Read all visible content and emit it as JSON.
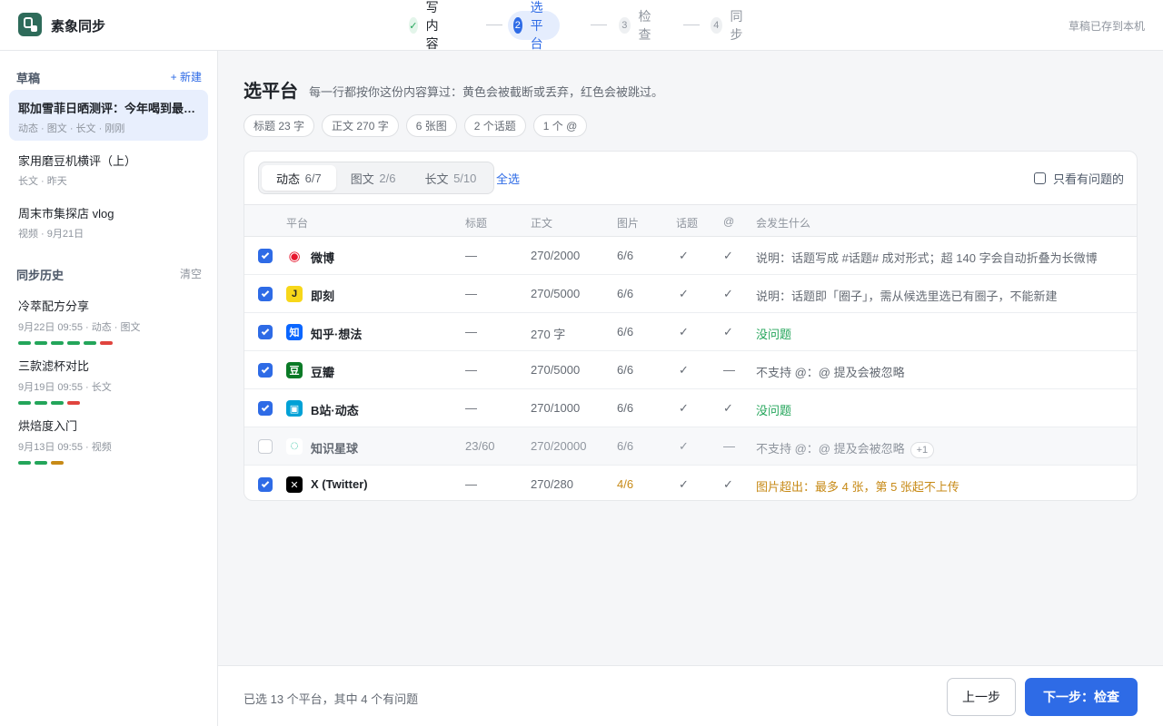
{
  "app": {
    "name": "素象同步",
    "saved_status": "草稿已存到本机"
  },
  "steps": [
    {
      "num": "✓",
      "label": "写内容"
    },
    {
      "num": "2",
      "label": "选平台"
    },
    {
      "num": "3",
      "label": "检查"
    },
    {
      "num": "4",
      "label": "同步"
    }
  ],
  "sidebar": {
    "drafts_title": "草稿",
    "new_label": "+ 新建",
    "drafts": [
      {
        "title": "耶加雪菲日晒测评：今年喝到最好的一支",
        "meta": "动态 · 图文 · 长文 · 刚刚"
      },
      {
        "title": "家用磨豆机横评（上）",
        "meta": "长文 · 昨天"
      },
      {
        "title": "周末市集探店 vlog",
        "meta": "视频 · 9月21日"
      }
    ],
    "history_title": "同步历史",
    "clear_label": "清空",
    "history": [
      {
        "title": "冷萃配方分享",
        "meta": "9月22日 09:55 · 动态 · 图文",
        "bars": [
          "green",
          "green",
          "green",
          "green",
          "green",
          "red"
        ]
      },
      {
        "title": "三款滤杯对比",
        "meta": "9月19日 09:55 · 长文",
        "bars": [
          "green",
          "green",
          "green",
          "red"
        ]
      },
      {
        "title": "烘焙度入门",
        "meta": "9月13日 09:55 · 视频",
        "bars": [
          "green",
          "green",
          "orange"
        ]
      }
    ]
  },
  "main": {
    "title": "选平台",
    "subtitle": "每一行都按你这份内容算过：黄色会被截断或丢弃，红色会被跳过。",
    "chips": [
      "标题 23 字",
      "正文 270 字",
      "6 张图",
      "2 个话题",
      "1 个 @"
    ],
    "tabs": [
      {
        "label": "动态",
        "count": "6/7"
      },
      {
        "label": "图文",
        "count": "2/6"
      },
      {
        "label": "长文",
        "count": "5/10"
      }
    ],
    "select_all": "全选",
    "only_problems": "只看有问题的",
    "columns": {
      "platform": "平台",
      "title": "标题",
      "body": "正文",
      "images": "图片",
      "topics": "话题",
      "at": "@",
      "what": "会发生什么"
    },
    "rows": [
      {
        "name": "微博",
        "icon": "weibo-icon",
        "glyph": "◉",
        "color": "#e6162d",
        "checked": true,
        "title": "—",
        "body": "270/2000",
        "images": "6/6",
        "topics": "✓",
        "at": "✓",
        "note": "说明：话题写成 #话题# 成对形式；超 140 字会自动折叠为长微博",
        "status": "info"
      },
      {
        "name": "即刻",
        "icon": "jike-icon",
        "glyph": "J",
        "color": "#f7d71a",
        "checked": true,
        "title": "—",
        "body": "270/5000",
        "images": "6/6",
        "topics": "✓",
        "at": "✓",
        "note": "说明：话题即「圈子」，需从候选里选已有圈子，不能新建",
        "status": "info"
      },
      {
        "name": "知乎·想法",
        "icon": "zhihu-icon",
        "glyph": "知",
        "color": "#0a66ff",
        "checked": true,
        "title": "—",
        "body": "270 字",
        "images": "6/6",
        "topics": "✓",
        "at": "✓",
        "note": "没问题",
        "status": "ok"
      },
      {
        "name": "豆瓣",
        "icon": "douban-icon",
        "glyph": "豆",
        "color": "#0a7a26",
        "checked": true,
        "title": "—",
        "body": "270/5000",
        "images": "6/6",
        "topics": "✓",
        "at": "—",
        "note": "不支持 @：@ 提及会被忽略",
        "status": "info"
      },
      {
        "name": "B站·动态",
        "icon": "bilibili-icon",
        "glyph": "▣",
        "color": "#00a1d6",
        "checked": true,
        "title": "—",
        "body": "270/1000",
        "images": "6/6",
        "topics": "✓",
        "at": "✓",
        "note": "没问题",
        "status": "ok"
      },
      {
        "name": "知识星球",
        "icon": "zsxq-icon",
        "glyph": "◌",
        "color": "#3ec5a8",
        "checked": false,
        "title": "23/60",
        "body": "270/20000",
        "images": "6/6",
        "topics": "✓",
        "at": "—",
        "note": "不支持 @：@ 提及会被忽略",
        "extra": "+1",
        "status": "info"
      },
      {
        "name": "X (Twitter)",
        "icon": "x-twitter-icon",
        "glyph": "✕",
        "color": "#000000",
        "checked": true,
        "title": "—",
        "body": "270/280",
        "images": "4/6",
        "topics": "✓",
        "at": "✓",
        "note": "图片超出：最多 4 张，第 5 张起不上传",
        "status": "warn"
      }
    ]
  },
  "footer": {
    "summary": "已选 13 个平台，其中 4 个有问题",
    "prev_label": "上一步",
    "next_label": "下一步：检查"
  },
  "colors": {
    "accent": "#2e6be6",
    "ok": "#23a55a",
    "warn": "#c78a17",
    "error": "#e0443e"
  }
}
